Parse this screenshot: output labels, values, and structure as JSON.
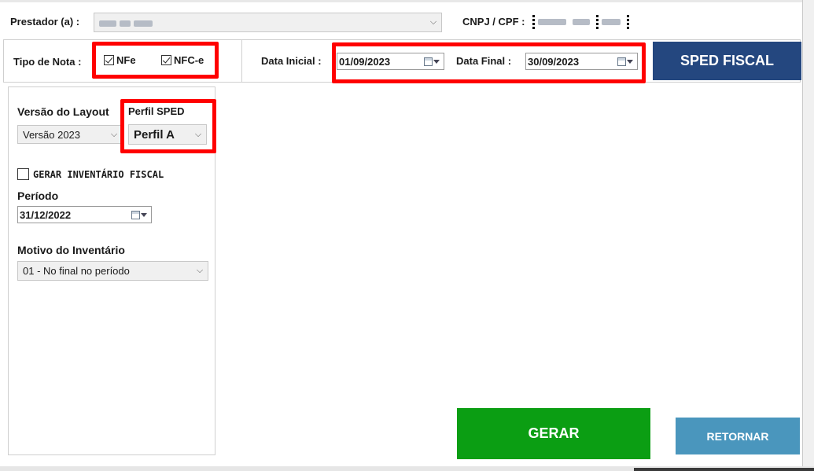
{
  "header": {
    "prestador_label": "Prestador (a) :",
    "cnpj_label": "CNPJ / CPF :"
  },
  "tipo_nota": {
    "label": "Tipo de Nota :",
    "nfe_label": "NFe",
    "nfe_checked": true,
    "nfce_label": "NFC-e",
    "nfce_checked": true
  },
  "dates": {
    "inicial_label": "Data Inicial :",
    "inicial_value": "01/09/2023",
    "final_label": "Data Final :",
    "final_value": "30/09/2023"
  },
  "sped_button": "SPED FISCAL",
  "layout": {
    "versao_label": "Versão do Layout",
    "versao_value": "Versão 2023",
    "perfil_label": "Perfil SPED",
    "perfil_value": "Perfil A"
  },
  "inventario": {
    "checkbox_label": "GERAR INVENTÁRIO FISCAL",
    "checked": false,
    "periodo_label": "Período",
    "periodo_value": "31/12/2022",
    "motivo_label": "Motivo do Inventário",
    "motivo_value": "01 - No final no período"
  },
  "actions": {
    "gerar": "GERAR",
    "retornar": "RETORNAR"
  },
  "colors": {
    "highlight": "#ff0000",
    "sped_button_bg": "#24477f",
    "gerar_bg": "#0b9e13",
    "retornar_bg": "#4a96bd"
  }
}
